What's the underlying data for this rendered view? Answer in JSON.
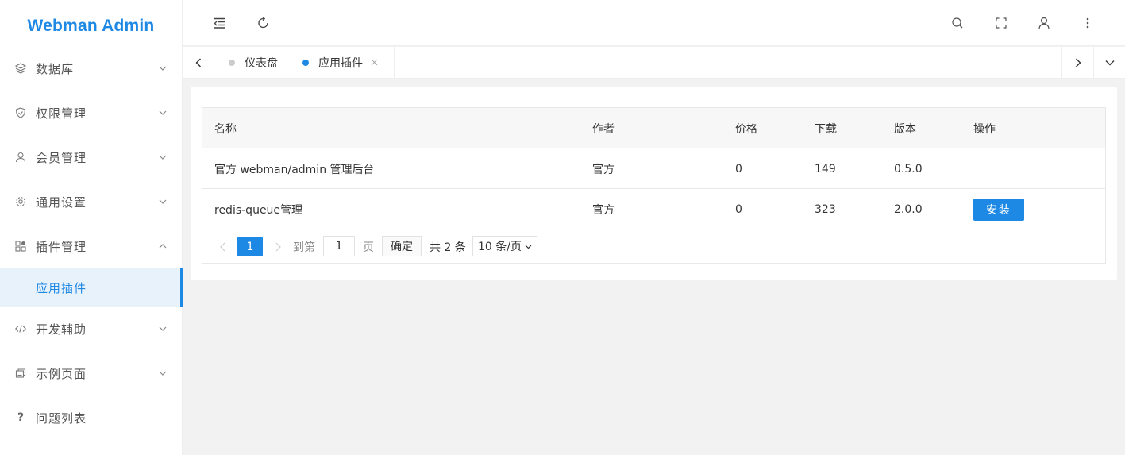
{
  "app": {
    "title": "Webman Admin"
  },
  "sidebar": {
    "items": [
      {
        "label": "数据库",
        "icon": "layers-icon",
        "expanded": false
      },
      {
        "label": "权限管理",
        "icon": "shield-icon",
        "expanded": false
      },
      {
        "label": "会员管理",
        "icon": "user-icon",
        "expanded": false
      },
      {
        "label": "通用设置",
        "icon": "gear-icon",
        "expanded": false
      },
      {
        "label": "插件管理",
        "icon": "apps-icon",
        "expanded": true
      },
      {
        "label": "开发辅助",
        "icon": "code-icon",
        "expanded": false
      },
      {
        "label": "示例页面",
        "icon": "pages-icon",
        "expanded": false
      },
      {
        "label": "问题列表",
        "icon": "question-icon",
        "expanded": null
      }
    ],
    "active_submenu": "应用插件"
  },
  "header": {
    "icons": [
      "menu-fold-icon",
      "refresh-icon",
      "search-icon",
      "fullscreen-icon",
      "user-icon",
      "more-icon"
    ]
  },
  "tabs": [
    {
      "label": "仪表盘",
      "active": false,
      "closable": false
    },
    {
      "label": "应用插件",
      "active": true,
      "closable": true
    }
  ],
  "table": {
    "columns": [
      "名称",
      "作者",
      "价格",
      "下载",
      "版本",
      "操作"
    ],
    "rows": [
      {
        "name": "官方 webman/admin 管理后台",
        "author": "官方",
        "price": "0",
        "downloads": "149",
        "version": "0.5.0",
        "action": ""
      },
      {
        "name": "redis-queue管理",
        "author": "官方",
        "price": "0",
        "downloads": "323",
        "version": "2.0.0",
        "action": "安装"
      }
    ]
  },
  "pagination": {
    "current_page": "1",
    "goto_prefix": "到第",
    "goto_value": "1",
    "goto_suffix": "页",
    "confirm_label": "确定",
    "total_text": "共 2 条",
    "page_size": "10 条/页"
  },
  "colors": {
    "accent": "#1e88e5",
    "tab_inactive_dot": "#cccccc"
  }
}
